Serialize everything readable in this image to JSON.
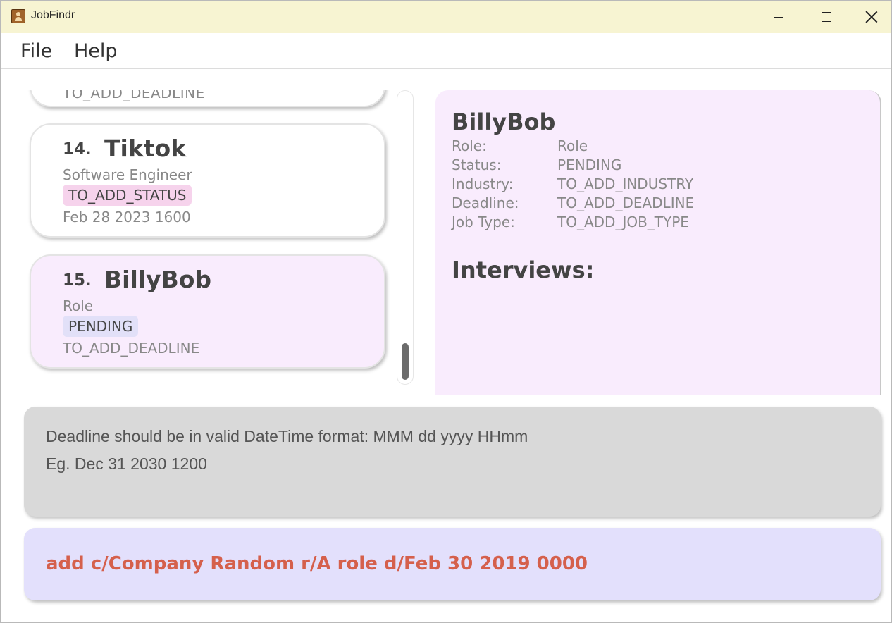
{
  "window": {
    "title": "JobFindr",
    "icon": "contact-book-icon"
  },
  "menu": {
    "file": "File",
    "help": "Help"
  },
  "list": {
    "partial_card_text": "TO_ADD_DEADLINE",
    "items": [
      {
        "index": "14.",
        "name": "Tiktok",
        "role": "Software Engineer",
        "status": "TO_ADD_STATUS",
        "status_color": "#f6d3ec",
        "deadline": "Feb 28 2023 1600"
      },
      {
        "index": "15.",
        "name": "BillyBob",
        "role": "Role",
        "status": "PENDING",
        "status_color": "#e2e0f8",
        "deadline": "TO_ADD_DEADLINE",
        "selected": true
      }
    ]
  },
  "detail": {
    "name": "BillyBob",
    "fields": [
      {
        "label": "Role:",
        "value": "Role"
      },
      {
        "label": "Status:",
        "value": "PENDING"
      },
      {
        "label": "Industry:",
        "value": "TO_ADD_INDUSTRY"
      },
      {
        "label": "Deadline:",
        "value": "TO_ADD_DEADLINE"
      },
      {
        "label": "Job Type:",
        "value": "TO_ADD_JOB_TYPE"
      }
    ],
    "interviews_heading": "Interviews:"
  },
  "result": {
    "lines": [
      "Deadline should be in valid DateTime format: MMM dd yyyy HHmm",
      "Eg. Dec 31 2030 1200"
    ]
  },
  "command": {
    "text": "add c/Company Random r/A role d/Feb 30 2019 0000",
    "color": "#d5604c"
  }
}
